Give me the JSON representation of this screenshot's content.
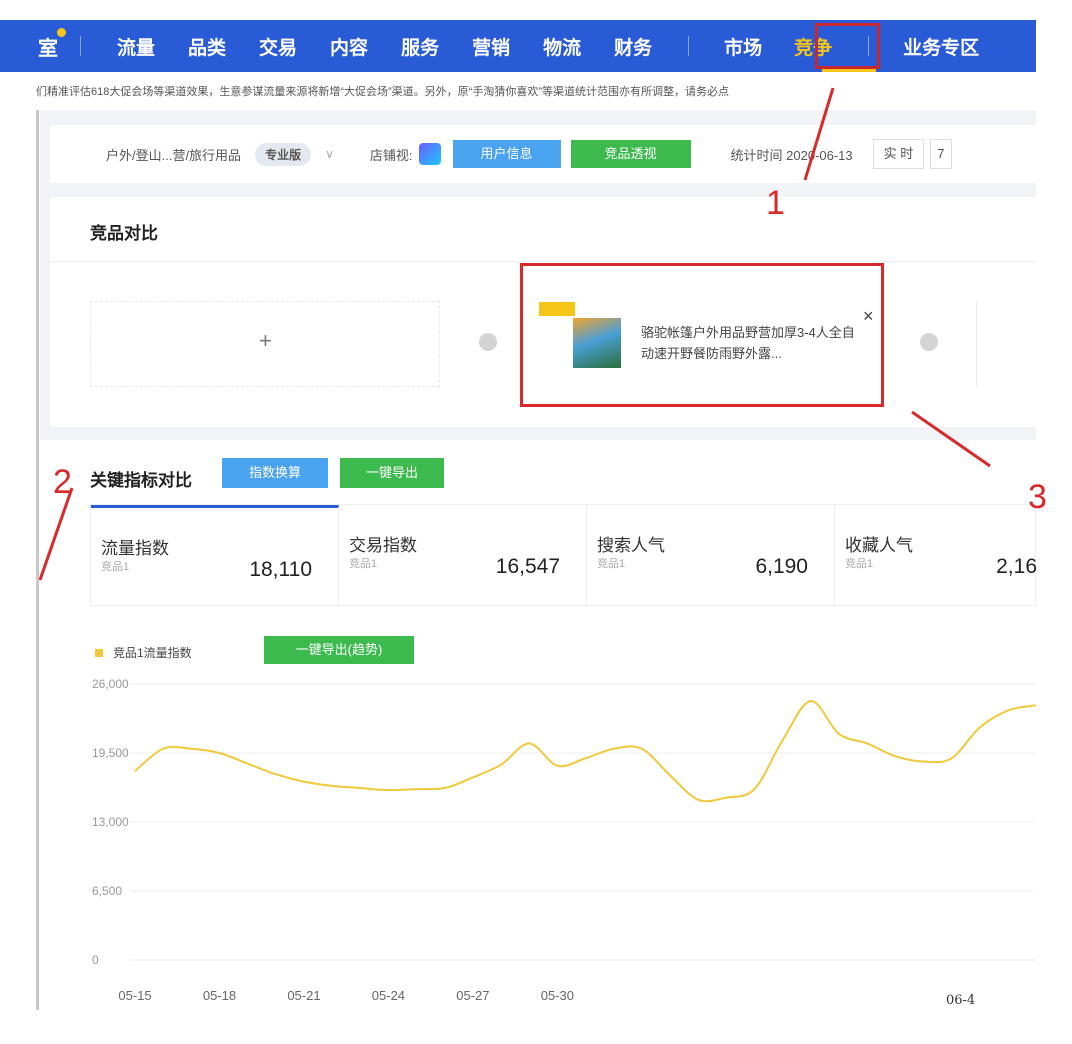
{
  "topnav": {
    "left_fragment": "室",
    "items": [
      {
        "label": "流量"
      },
      {
        "label": "品类"
      },
      {
        "label": "交易"
      },
      {
        "label": "内容"
      },
      {
        "label": "服务"
      },
      {
        "label": "营销"
      },
      {
        "label": "物流"
      },
      {
        "label": "财务"
      }
    ],
    "market": "市场",
    "active": "竞争",
    "business": "业务专区",
    "colors": {
      "bar": "#2a5bd7",
      "active": "#f5c518"
    }
  },
  "notice": "们精准评估618大促会场等渠道效果，生意参谋流量来源将新增“大促会场”渠道。另外，原“手淘猜你喜欢”等渠道统计范围亦有所调整，请务必点",
  "filter": {
    "category": "户外/登山...营/旅行用品",
    "edition": "专业版",
    "shop_view_label": "店铺视:",
    "user_info": "用户信息",
    "product_view": "竞品透视",
    "stat_time": "统计时间 2020-06-13",
    "realtime": "实 时",
    "seven": "7"
  },
  "compare": {
    "title": "竞品对比",
    "add": "+",
    "product_name": "骆驼帐篷户外用品野营加厚3-4人全自动速开野餐防雨野外露...",
    "close": "×"
  },
  "metrics": {
    "title": "关键指标对比",
    "btn_convert": "指数换算",
    "btn_export": "一键导出",
    "btn_export_trend": "一键导出(趋势)",
    "cards": [
      {
        "name": "流量指数",
        "sub": "竞品1",
        "value": "18,110"
      },
      {
        "name": "交易指数",
        "sub": "竞品1",
        "value": "16,547"
      },
      {
        "name": "搜索人气",
        "sub": "竞品1",
        "value": "6,190"
      },
      {
        "name": "收藏人气",
        "sub": "竞品1",
        "value": "2,16"
      }
    ],
    "legend": "竞品1流量指数"
  },
  "annotations": {
    "a1": "1",
    "a2": "2",
    "a3": "3"
  },
  "chart_data": {
    "type": "line",
    "series": [
      {
        "name": "竞品1流量指数",
        "color": "#f0c93a",
        "values": [
          17800,
          19900,
          19900,
          19500,
          18500,
          17500,
          16800,
          16400,
          16200,
          16000,
          16100,
          16200,
          17200,
          18400,
          20400,
          18300,
          19000,
          19900,
          19900,
          17400,
          15100,
          15300,
          16100,
          20700,
          24400,
          21300,
          20400,
          19200,
          18700,
          19000,
          21900,
          23500,
          24000
        ]
      }
    ],
    "x_labels": [
      "05-15",
      "05-18",
      "05-21",
      "05-24",
      "05-27",
      "05-30"
    ],
    "x_label_indices": [
      0,
      3,
      6,
      9,
      12,
      15
    ],
    "extra_x_label": "06-4",
    "y_ticks": [
      "26,000",
      "19,500",
      "13,000",
      "6,500",
      "0"
    ],
    "ylim": [
      0,
      26000
    ],
    "grid": true
  }
}
